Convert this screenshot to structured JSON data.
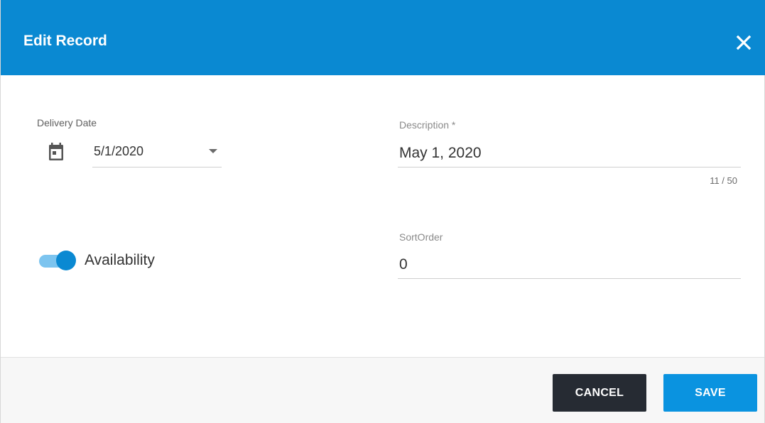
{
  "dialog": {
    "title": "Edit Record",
    "header_color": "#0a89d2",
    "close_icon": "close-icon"
  },
  "form": {
    "delivery_date": {
      "label": "Delivery Date",
      "value": "5/1/2020",
      "icon": "calendar-icon"
    },
    "description": {
      "label": "Description *",
      "value": "May 1, 2020",
      "counter": "11 / 50"
    },
    "availability": {
      "label": "Availability",
      "checked": true
    },
    "sort_order": {
      "label": "SortOrder",
      "value": "0"
    }
  },
  "footer": {
    "cancel_label": "CANCEL",
    "save_label": "SAVE"
  }
}
